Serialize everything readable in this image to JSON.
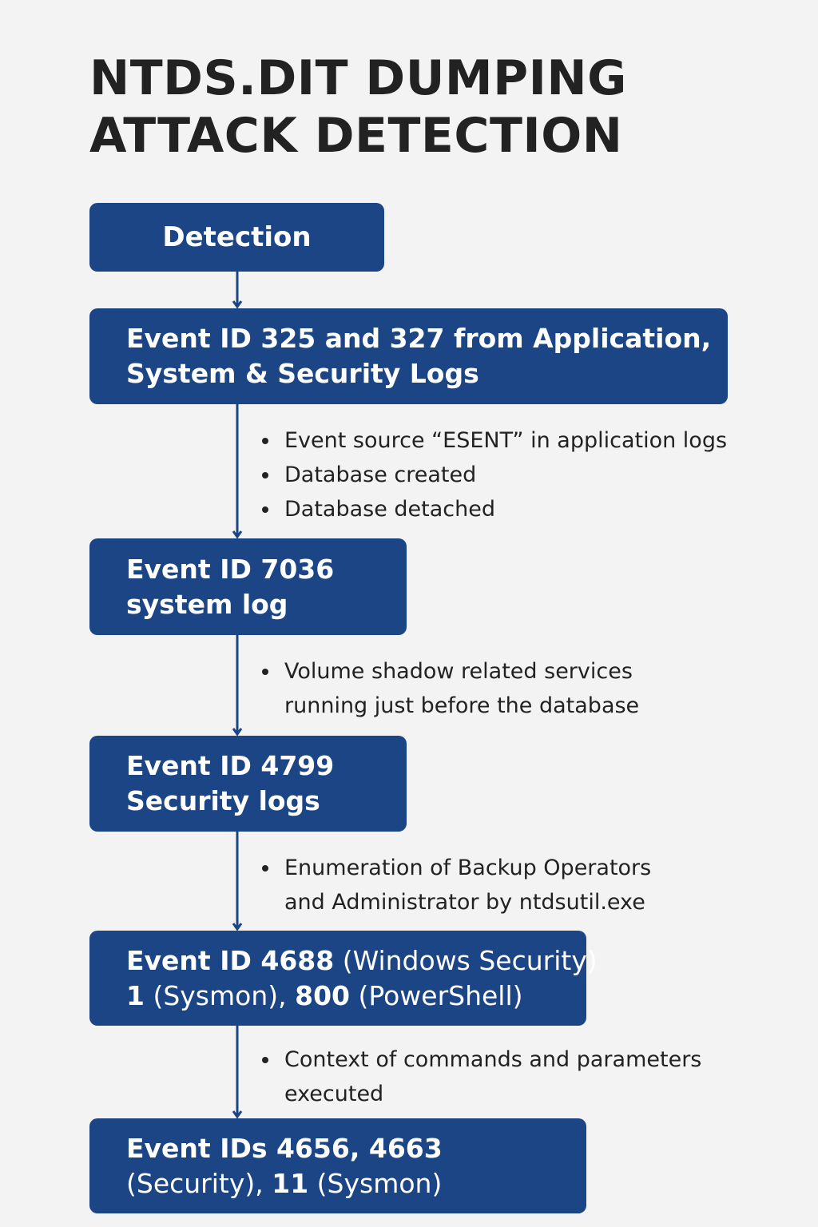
{
  "title": {
    "line1": "NTDS.DIT DUMPING",
    "line2": "ATTACK DETECTION"
  },
  "colors": {
    "box_fill": "#1c4585",
    "box_text": "#ffffff",
    "background": "#f3f3f3"
  },
  "nodes": {
    "detection": {
      "label": "Detection"
    },
    "event_325_327": {
      "line1": "Event ID 325 and 327 from Application,",
      "line2": "System & Security Logs"
    },
    "event_7036": {
      "line1": "Event ID 7036",
      "line2": "system log"
    },
    "event_4799": {
      "line1": "Event ID 4799",
      "line2": "Security logs"
    },
    "event_4688": {
      "line1_bold": "Event ID 4688",
      "line1_reg": " (Windows Security)",
      "line2_bold_a": "1",
      "line2_reg_a": " (Sysmon), ",
      "line2_bold_b": "800",
      "line2_reg_b": " (PowerShell)"
    },
    "event_4656_4663": {
      "line1": "Event IDs 4656, 4663",
      "line2_reg_a": "(Security), ",
      "line2_bold": "11",
      "line2_reg_b": " (Sysmon)"
    }
  },
  "notes": {
    "after_325_327": [
      "Event source “ESENT” in application logs",
      "Database created",
      "Database detached"
    ],
    "after_7036": {
      "line1": "Volume shadow related services",
      "line2": "running just before the database"
    },
    "after_4799": {
      "line1": "Enumeration of Backup Operators",
      "line2": "and Administrator by ntdsutil.exe"
    },
    "after_4688": {
      "line1": "Context of commands and parameters",
      "line2": "executed"
    }
  }
}
